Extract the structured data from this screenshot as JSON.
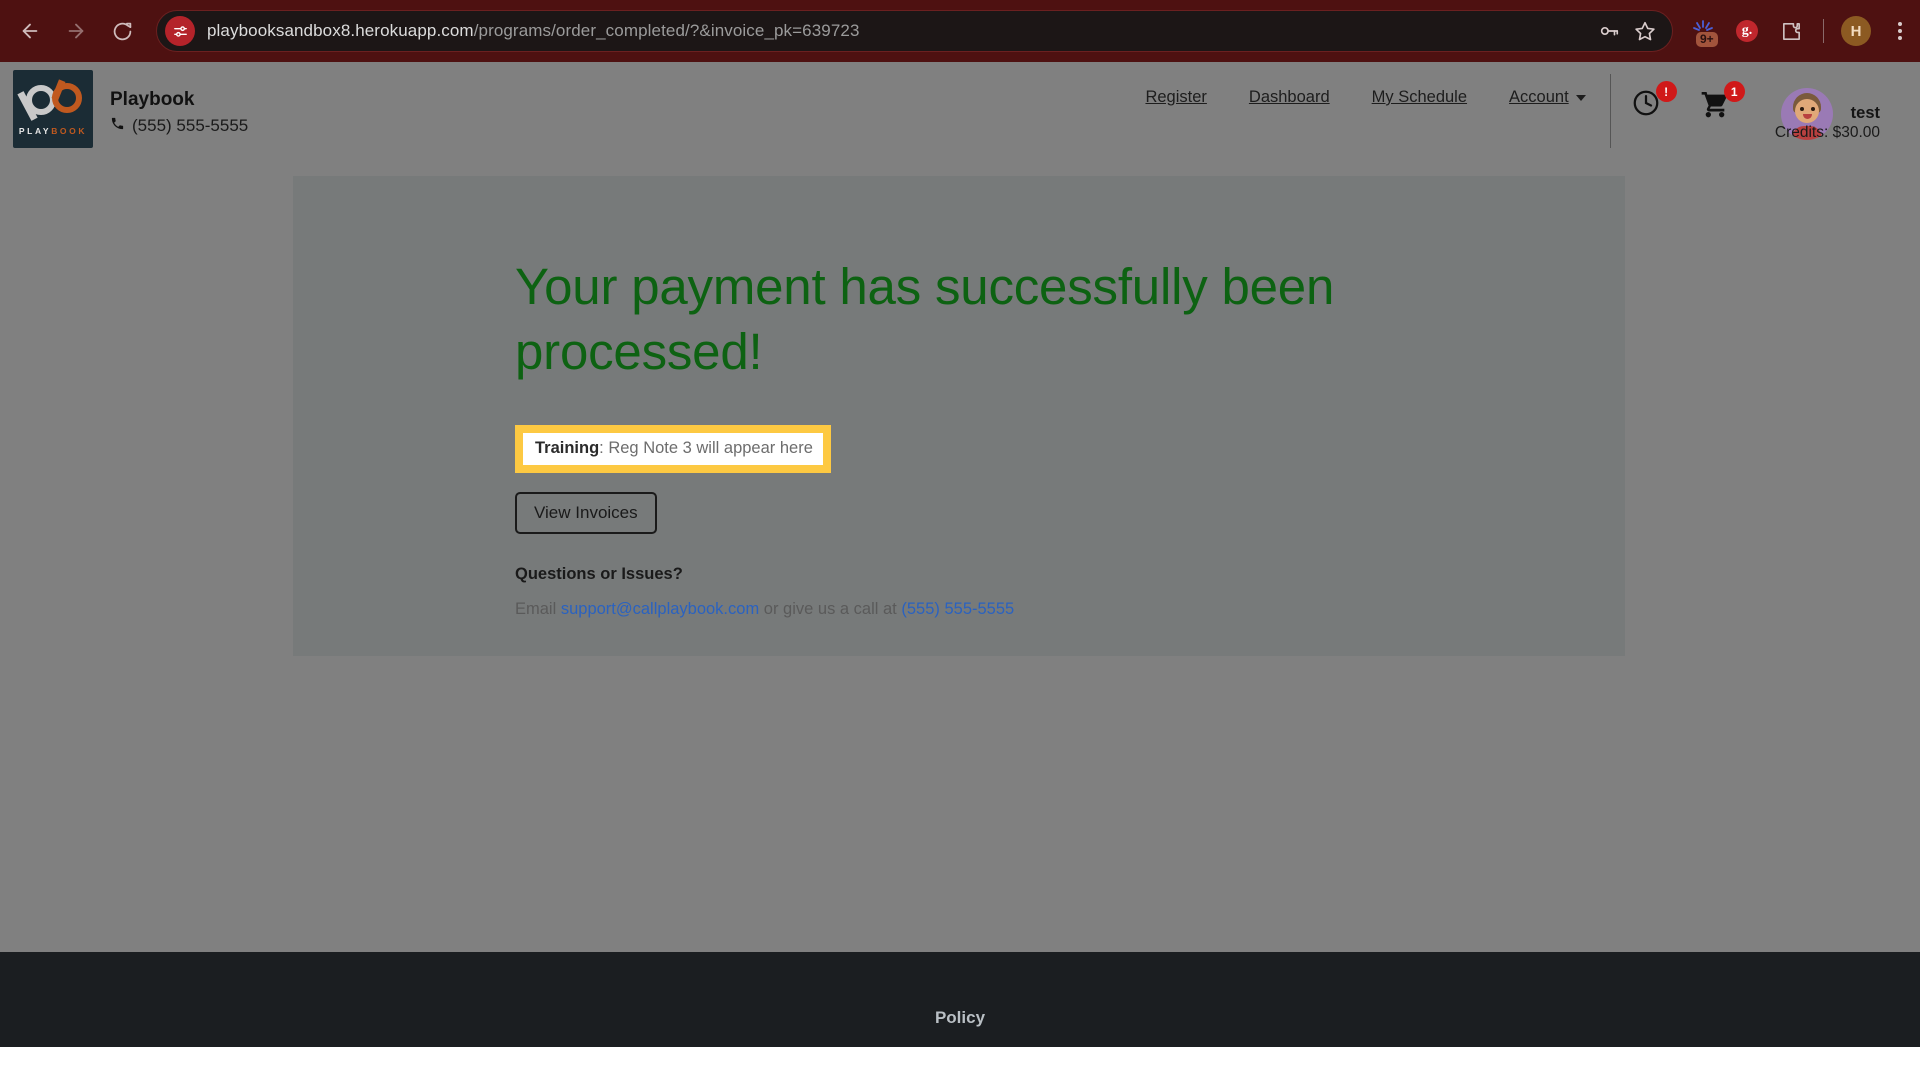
{
  "browser": {
    "back_label": "Back",
    "forward_label": "Forward",
    "reload_label": "Reload",
    "site_info_icon": "tune-icon",
    "url_domain": "playbooksandbox8.herokuapp.com",
    "url_path": "/programs/order_completed/?&invoice_pk=639723",
    "password_manager_label": "Passwords",
    "bookmark_label": "Bookmark this tab",
    "extension_badge": "9+",
    "grammarly_label": "g.",
    "extensions_label": "Extensions",
    "profile_initial": "H",
    "menu_label": "Customize and control Chrome"
  },
  "header": {
    "logo_word_light": "PLAY",
    "logo_word_accent": "BOOK",
    "brand_name": "Playbook",
    "brand_phone": "(555) 555-5555",
    "nav": [
      {
        "label": "Register"
      },
      {
        "label": "Dashboard"
      },
      {
        "label": "My Schedule"
      },
      {
        "label": "Account"
      }
    ],
    "history_badge": "!",
    "cart_badge": "1",
    "username": "test",
    "credits": "Credits: $30.00"
  },
  "main": {
    "success_heading": "Your payment has successfully been processed!",
    "training_label": "Training",
    "training_text": ": Reg Note 3 will appear here",
    "view_invoices_label": "View Invoices",
    "questions_title": "Questions or Issues?",
    "contact_prefix": "Email ",
    "contact_email": "support@callplaybook.com",
    "contact_middle": " or give us a call at ",
    "contact_phone": "(555) 555-5555"
  },
  "footer": {
    "policy_label": "Policy"
  },
  "colors": {
    "chrome_bg": "#4e1111",
    "success_green": "#0d6212",
    "highlight_yellow": "#fdc942",
    "link_blue": "#2a62c0",
    "badge_red": "#d01919",
    "logo_navy": "#1b2c35",
    "logo_orange": "#c0591f",
    "footer_bg": "#1b1e21"
  }
}
